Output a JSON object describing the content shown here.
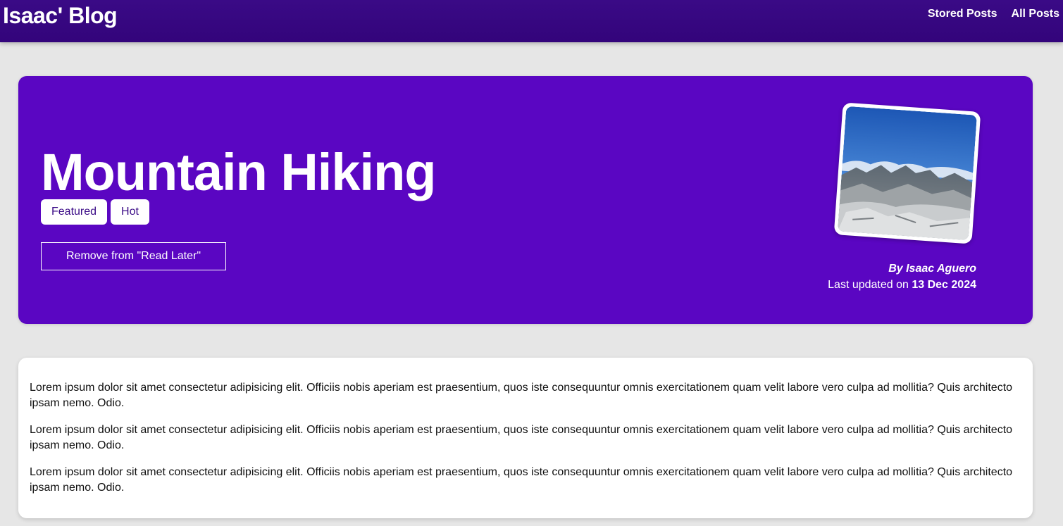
{
  "header": {
    "site_title": "Isaac' Blog",
    "nav": [
      "Stored Posts",
      "All Posts"
    ]
  },
  "hero": {
    "title": "Mountain Hiking",
    "tags": [
      "Featured",
      "Hot"
    ],
    "read_later_label": "Remove from \"Read Later\"",
    "author": "By Isaac Aguero",
    "updated_prefix": "Last updated on ",
    "updated_date": "13 Dec 2024"
  },
  "content": {
    "paragraphs": [
      "Lorem ipsum dolor sit amet consectetur adipisicing elit. Officiis nobis aperiam est praesentium, quos iste consequuntur omnis exercitationem quam velit labore vero culpa ad mollitia? Quis architecto ipsam nemo. Odio.",
      "Lorem ipsum dolor sit amet consectetur adipisicing elit. Officiis nobis aperiam est praesentium, quos iste consequuntur omnis exercitationem quam velit labore vero culpa ad mollitia? Quis architecto ipsam nemo. Odio.",
      "Lorem ipsum dolor sit amet consectetur adipisicing elit. Officiis nobis aperiam est praesentium, quos iste consequuntur omnis exercitationem quam velit labore vero culpa ad mollitia? Quis architecto ipsam nemo. Odio."
    ]
  },
  "colors": {
    "header_bg": "#3a0a86",
    "hero_bg": "#5a06c2",
    "page_bg": "#e6e6e6"
  }
}
